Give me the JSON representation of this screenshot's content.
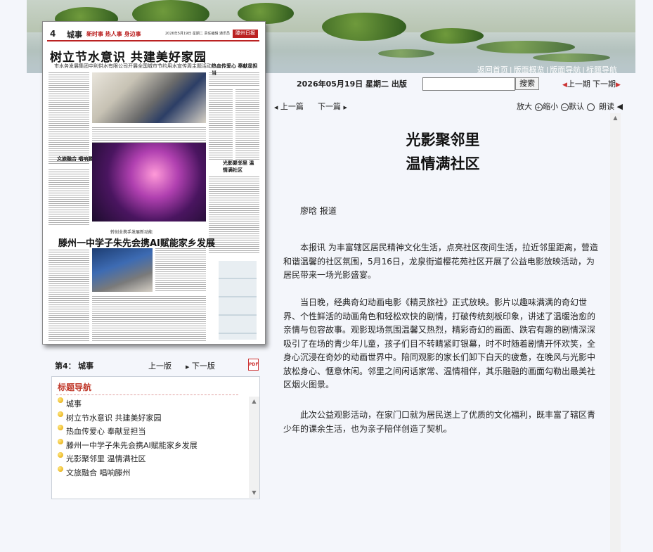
{
  "top_links": [
    "返回首页",
    "版面概览",
    "版面导航",
    "标题导航"
  ],
  "newspaper": {
    "page_number": "4",
    "section": "城事",
    "tagline": "新时事 热人事 身边事",
    "date_text": "2026年5月19日 星期二 责任编辑 通讯员",
    "logo": "滕州日报",
    "headline": "树立节水意识 共建美好家园",
    "subheadline": "市水务发展集团中利供水有限公司开展全国城市节约用水宣传周主题活动",
    "kicker2": "转创业携手发展新动能",
    "headline2": "滕州一中学子朱先会携AI赋能家乡发展",
    "side_items": [
      "热血传爱心 奉献显担当",
      "文旅融合 唱响滕州",
      "光影聚邻里 温情满社区"
    ]
  },
  "page_info": {
    "label": "第4：",
    "section": "城事"
  },
  "page_nav": {
    "prev": "上一版",
    "next": "下一版",
    "pdf": "PDF"
  },
  "title_nav": {
    "header": "标题导航",
    "items": [
      "城事",
      "树立节水意识 共建美好家园",
      "热血传爱心 奉献显担当",
      "滕州一中学子朱先会携AI赋能家乡发展",
      "光影聚邻里 温情满社区",
      "文旅融合 唱响滕州"
    ]
  },
  "issue": {
    "date": "2026年05月19日 星期二 出版",
    "search_button": "搜索",
    "prev_issue": "上一期",
    "next_issue": "下一期"
  },
  "article_nav": {
    "prev": "上一篇",
    "next": "下一篇"
  },
  "tools": {
    "zoom_in": "放大",
    "zoom_out": "缩小",
    "default": "默认",
    "read": "朗读"
  },
  "article": {
    "title_line1": "光影聚邻里",
    "title_line2": "温情满社区",
    "byline": "廖晗 报道",
    "paragraphs": [
      "本报讯 为丰富辖区居民精神文化生活，点亮社区夜间生活，拉近邻里距离，营造和谐温馨的社区氛围，5月16日，龙泉街道樱花苑社区开展了公益电影放映活动，为居民带来一场光影盛宴。",
      "当日晚，经典奇幻动画电影《精灵旅社》正式放映。影片以趣味满满的奇幻世界、个性鲜活的动画角色和轻松欢快的剧情，打破传统刻板印象，讲述了温暖治愈的亲情与包容故事。观影现场氛围温馨又热烈，精彩奇幻的画面、跌宕有趣的剧情深深吸引了在场的青少年儿童，孩子们目不转睛紧盯银幕，时不时随着剧情开怀欢笑，全身心沉浸在奇妙的动画世界中。陪同观影的家长们卸下白天的疲惫，在晚风与光影中放松身心、惬意休闲。邻里之间闲话家常、温情相伴，其乐融融的画面勾勒出最美社区烟火图景。",
      "此次公益观影活动，在家门口就为居民送上了优质的文化福利，既丰富了辖区青少年的课余生活，也为亲子陪伴创造了契机。"
    ]
  }
}
